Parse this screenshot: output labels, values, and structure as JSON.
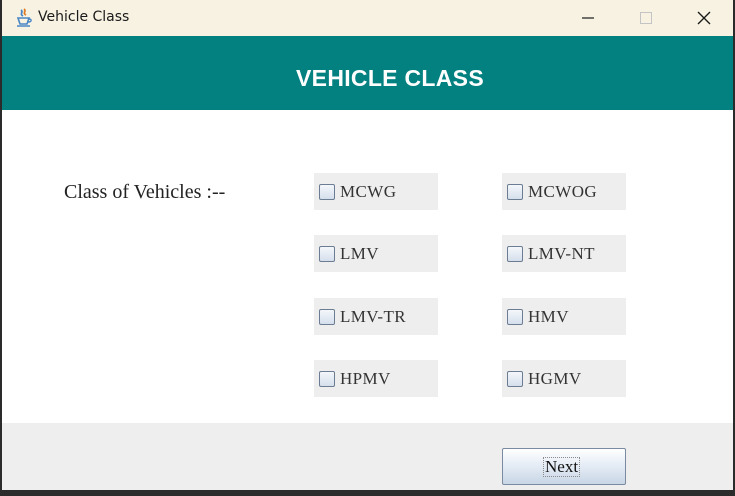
{
  "window": {
    "title": "Vehicle Class",
    "controls": {
      "minimize": "minimize",
      "maximize": "maximize",
      "close": "close"
    }
  },
  "header": {
    "title": "VEHICLE CLASS",
    "color": "#038080"
  },
  "form": {
    "label": "Class of Vehicles :--",
    "checkboxes": [
      {
        "label": "MCWG",
        "checked": false
      },
      {
        "label": "MCWOG",
        "checked": false
      },
      {
        "label": "LMV",
        "checked": false
      },
      {
        "label": "LMV-NT",
        "checked": false
      },
      {
        "label": "LMV-TR",
        "checked": false
      },
      {
        "label": "HMV",
        "checked": false
      },
      {
        "label": "HPMV",
        "checked": false
      },
      {
        "label": "HGMV",
        "checked": false
      }
    ]
  },
  "footer": {
    "next_label": "Next"
  },
  "icons": {
    "app": "java-cup-icon",
    "minimize": "minimize-icon",
    "maximize": "maximize-icon",
    "close": "close-icon"
  }
}
